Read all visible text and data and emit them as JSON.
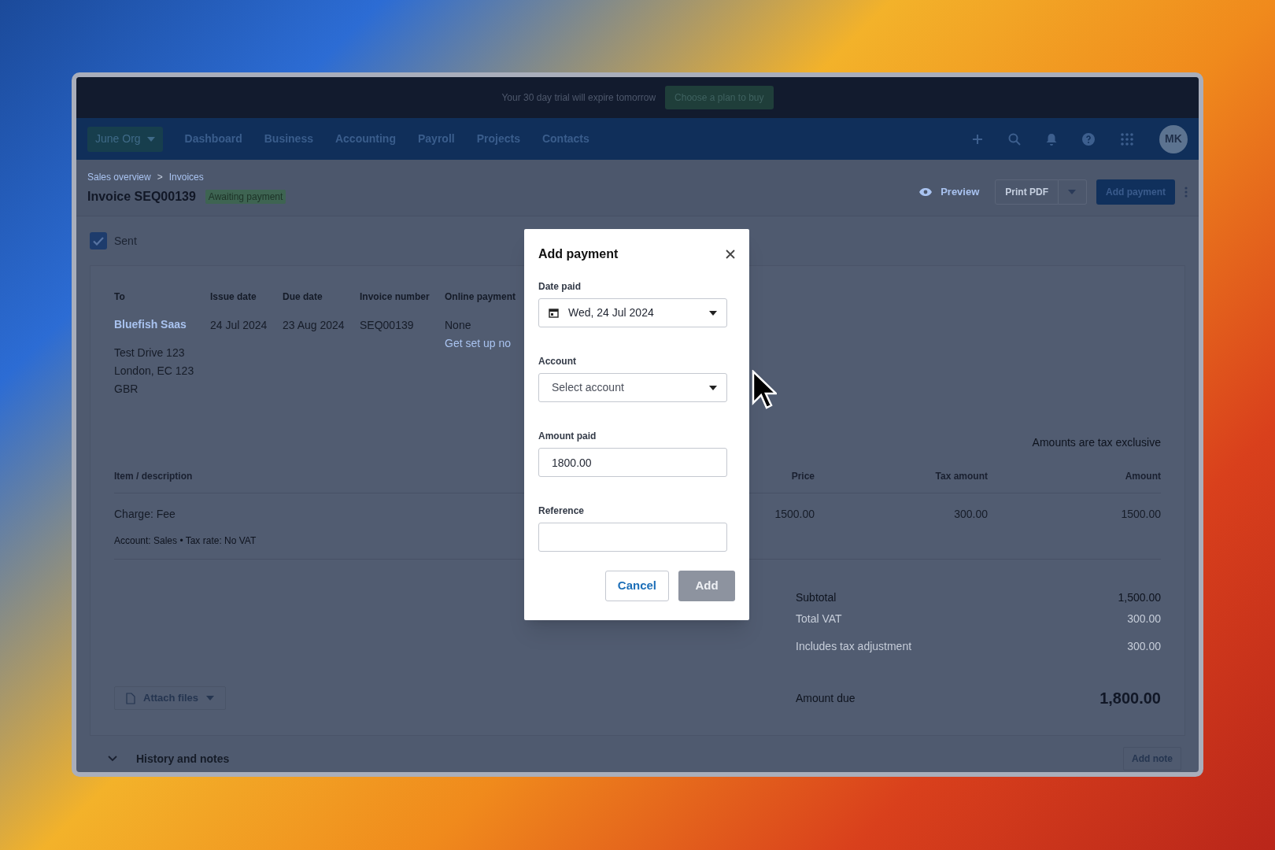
{
  "banner": {
    "message": "Your 30 day trial will expire tomorrow",
    "action": "Choose a plan to buy"
  },
  "nav": {
    "org": "June Org",
    "items": [
      {
        "label": "Dashboard"
      },
      {
        "label": "Business"
      },
      {
        "label": "Accounting"
      },
      {
        "label": "Payroll"
      },
      {
        "label": "Projects"
      },
      {
        "label": "Contacts"
      }
    ],
    "avatar": "MK"
  },
  "breadcrumbs": {
    "items": [
      "Sales overview",
      "Invoices"
    ],
    "separator": ">"
  },
  "invoice": {
    "title": "Invoice SEQ00139",
    "status": "Awaiting payment"
  },
  "actions": {
    "preview": "Preview",
    "print": "Print PDF",
    "add_payment": "Add payment"
  },
  "sent": {
    "label": "Sent",
    "checked": true
  },
  "details": [
    {
      "heading": "To",
      "lines": [
        {
          "text": "Bluefish Saas",
          "kind": "link"
        },
        {
          "text": "Test Drive 123",
          "kind": "text"
        },
        {
          "text": "London, EC 123",
          "kind": "text"
        },
        {
          "text": "GBR",
          "kind": "text"
        }
      ]
    },
    {
      "heading": "Issue date",
      "lines": [
        {
          "text": "24 Jul 2024",
          "kind": "text"
        }
      ]
    },
    {
      "heading": "Due date",
      "lines": [
        {
          "text": "23 Aug 2024",
          "kind": "text"
        }
      ]
    },
    {
      "heading": "Invoice number",
      "lines": [
        {
          "text": "SEQ00139",
          "kind": "text"
        }
      ]
    },
    {
      "heading": "Online payment",
      "lines": [
        {
          "text": "None",
          "kind": "text"
        },
        {
          "text": "Get set up no",
          "kind": "link"
        }
      ]
    }
  ],
  "tax_note": "Amounts are tax exclusive",
  "table": {
    "columns": [
      "Item / description",
      "Price",
      "Tax amount",
      "Amount"
    ],
    "rows": [
      {
        "description": "Charge: Fee",
        "meta": "Account: Sales • Tax rate: No VAT",
        "price": "1500.00",
        "tax": "300.00",
        "amount": "1500.00"
      }
    ]
  },
  "totals": [
    {
      "label": "Subtotal",
      "value": "1,500.00",
      "kind": "normal"
    },
    {
      "label": "Total VAT",
      "value": "300.00",
      "kind": "muted"
    },
    {
      "label": "Includes tax adjustment",
      "value": "300.00",
      "kind": "muted"
    },
    {
      "label": "Amount due",
      "value": "1,800.00",
      "kind": "due"
    }
  ],
  "attach": "Attach files",
  "history": {
    "title": "History and notes",
    "add": "Add note"
  },
  "modal": {
    "title": "Add payment",
    "fields": [
      {
        "label": "Date paid",
        "kind": "date",
        "value": "Wed, 24 Jul 2024"
      },
      {
        "label": "Account",
        "kind": "select",
        "placeholder": "Select account"
      },
      {
        "label": "Amount paid",
        "kind": "text",
        "value": "1800.00"
      },
      {
        "label": "Reference",
        "kind": "text"
      }
    ],
    "cancel": "Cancel",
    "confirm": {
      "label": "Add",
      "disabled": true
    }
  }
}
